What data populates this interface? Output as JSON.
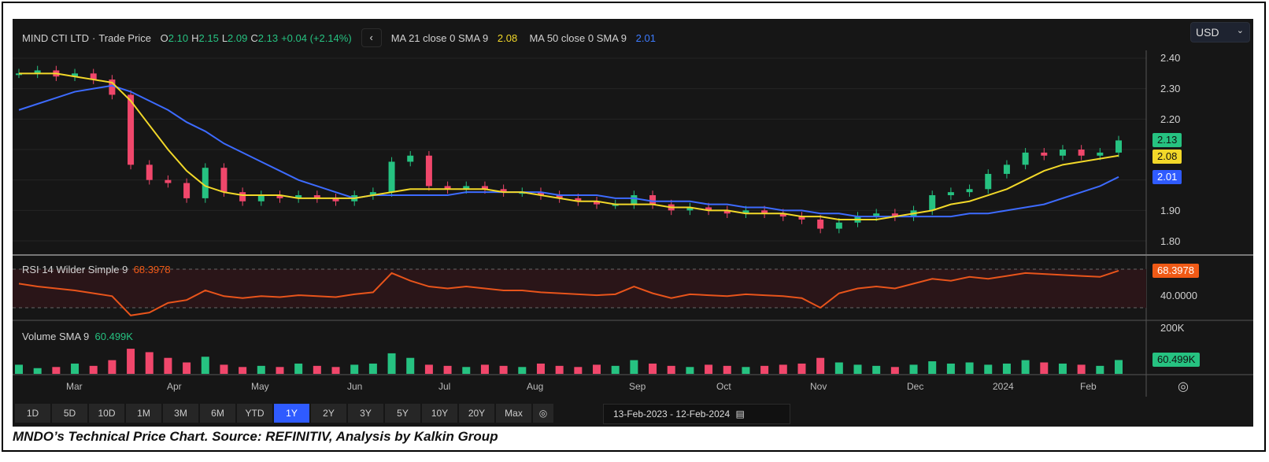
{
  "header": {
    "symbol": "MIND CTI LTD",
    "separator": "·",
    "price_type": "Trade Price",
    "o_label": "O",
    "o": "2.10",
    "h_label": "H",
    "h": "2.15",
    "l_label": "L",
    "l": "2.09",
    "c_label": "C",
    "c": "2.13",
    "change": "+0.04 (+2.14%)",
    "collapse_icon": "‹",
    "ma21_label": "MA 21 close 0 SMA 9",
    "ma21_value": "2.08",
    "ma50_label": "MA 50 close 0 SMA 9",
    "ma50_value": "2.01"
  },
  "currency": {
    "value": "USD",
    "icon": "chevron-down"
  },
  "axis": {
    "price_ticks": [
      "2.40",
      "2.30",
      "2.20",
      "1.90",
      "1.80"
    ],
    "rsi_tick": "40.0000",
    "volume_tick": "200K"
  },
  "tags": {
    "close": "2.13",
    "ma21": "2.08",
    "ma50": "2.01",
    "rsi": "68.3978",
    "volume": "60.499K"
  },
  "rsi": {
    "label": "RSI 14 Wilder Simple 9",
    "value": "68.3978"
  },
  "volume": {
    "label": "Volume SMA 9",
    "value": "60.499K"
  },
  "months": [
    "Mar",
    "Apr",
    "May",
    "Jun",
    "Jul",
    "Aug",
    "Sep",
    "Oct",
    "Nov",
    "Dec",
    "2024",
    "Feb"
  ],
  "ranges": [
    "1D",
    "5D",
    "10D",
    "1M",
    "3M",
    "6M",
    "YTD",
    "1Y",
    "2Y",
    "3Y",
    "5Y",
    "10Y",
    "20Y",
    "Max"
  ],
  "active_range": "1Y",
  "date_range": {
    "from": "13-Feb-2023",
    "dash": "-",
    "to": "12-Feb-2024"
  },
  "caption": "MNDO’s Technical Price Chart. Source: REFINITIV, Analysis by Kalkin Group",
  "colors": {
    "up": "#26c281",
    "down": "#f0476b",
    "ma21": "#f2d829",
    "ma50": "#3d6bff",
    "rsi": "#e8541b",
    "active": "#2f5bff"
  },
  "chart_data": {
    "type": "candlestick",
    "title": "MIND CTI LTD · Trade Price",
    "x_range": [
      "13-Feb-2023",
      "12-Feb-2024"
    ],
    "ylim": [
      1.78,
      2.44
    ],
    "close": [
      2.35,
      2.36,
      2.34,
      2.35,
      2.33,
      2.28,
      2.05,
      2.0,
      1.99,
      1.94,
      2.04,
      1.96,
      1.93,
      1.95,
      1.94,
      1.95,
      1.94,
      1.93,
      1.95,
      1.96,
      2.06,
      2.08,
      1.98,
      1.97,
      1.98,
      1.97,
      1.96,
      1.96,
      1.95,
      1.94,
      1.93,
      1.92,
      1.92,
      1.95,
      1.92,
      1.9,
      1.91,
      1.9,
      1.89,
      1.9,
      1.89,
      1.88,
      1.87,
      1.84,
      1.86,
      1.88,
      1.89,
      1.88,
      1.9,
      1.95,
      1.96,
      1.97,
      2.02,
      2.05,
      2.09,
      2.08,
      2.1,
      2.08,
      2.09,
      2.13
    ],
    "ma21": [
      2.35,
      2.35,
      2.35,
      2.34,
      2.33,
      2.32,
      2.26,
      2.18,
      2.1,
      2.03,
      1.98,
      1.96,
      1.95,
      1.95,
      1.95,
      1.94,
      1.94,
      1.94,
      1.94,
      1.95,
      1.96,
      1.97,
      1.97,
      1.97,
      1.97,
      1.97,
      1.96,
      1.96,
      1.95,
      1.94,
      1.93,
      1.93,
      1.92,
      1.92,
      1.92,
      1.91,
      1.91,
      1.9,
      1.9,
      1.89,
      1.89,
      1.89,
      1.88,
      1.88,
      1.87,
      1.87,
      1.87,
      1.88,
      1.89,
      1.9,
      1.92,
      1.93,
      1.95,
      1.97,
      2.0,
      2.03,
      2.05,
      2.06,
      2.07,
      2.08
    ],
    "ma50": [
      2.23,
      2.25,
      2.27,
      2.29,
      2.3,
      2.31,
      2.29,
      2.26,
      2.23,
      2.19,
      2.16,
      2.12,
      2.09,
      2.06,
      2.03,
      2.0,
      1.98,
      1.96,
      1.94,
      1.95,
      1.95,
      1.95,
      1.95,
      1.95,
      1.96,
      1.96,
      1.96,
      1.96,
      1.96,
      1.95,
      1.95,
      1.95,
      1.94,
      1.94,
      1.93,
      1.93,
      1.93,
      1.92,
      1.92,
      1.91,
      1.91,
      1.9,
      1.9,
      1.89,
      1.89,
      1.88,
      1.88,
      1.88,
      1.88,
      1.88,
      1.88,
      1.89,
      1.89,
      1.9,
      1.91,
      1.92,
      1.94,
      1.96,
      1.98,
      2.01
    ],
    "rsi": [
      55,
      52,
      50,
      48,
      45,
      42,
      22,
      25,
      35,
      38,
      48,
      42,
      40,
      42,
      41,
      43,
      42,
      41,
      44,
      46,
      66,
      58,
      52,
      50,
      52,
      50,
      48,
      48,
      46,
      45,
      44,
      43,
      44,
      52,
      45,
      40,
      44,
      43,
      42,
      44,
      43,
      42,
      40,
      30,
      45,
      50,
      52,
      50,
      55,
      60,
      58,
      62,
      60,
      63,
      66,
      65,
      64,
      63,
      62,
      68.4
    ],
    "rsi_bands": [
      30,
      70
    ],
    "volume_k": [
      40,
      25,
      30,
      45,
      35,
      60,
      110,
      95,
      70,
      50,
      75,
      40,
      30,
      35,
      30,
      45,
      35,
      30,
      40,
      45,
      90,
      70,
      40,
      35,
      30,
      40,
      35,
      30,
      45,
      35,
      30,
      40,
      35,
      60,
      45,
      35,
      30,
      40,
      35,
      30,
      35,
      40,
      45,
      70,
      50,
      40,
      35,
      30,
      40,
      55,
      45,
      50,
      40,
      45,
      60,
      50,
      45,
      40,
      35,
      60.5
    ],
    "volume_max_k": 200
  }
}
